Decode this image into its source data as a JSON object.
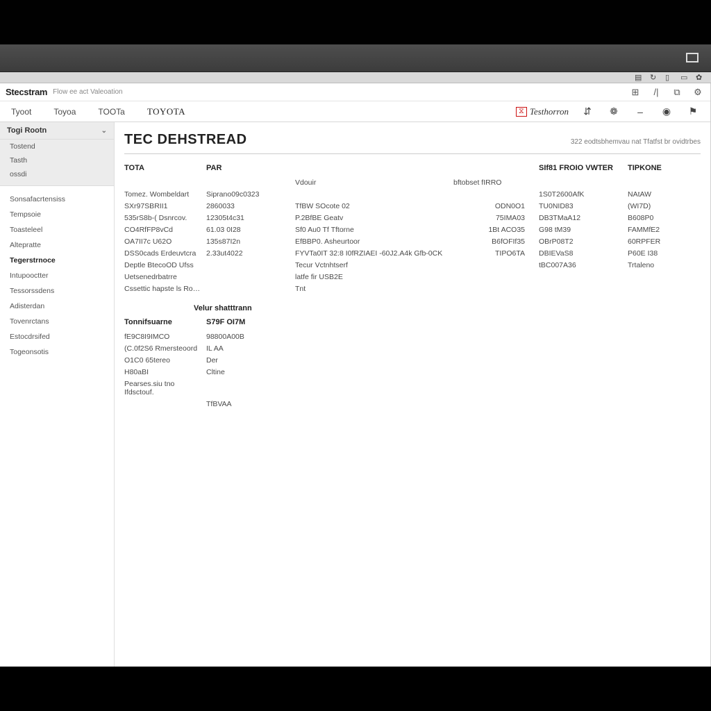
{
  "brand": {
    "name": "Stecstram",
    "sub": "Flow ee act  Valeoation"
  },
  "topTabs": [
    "Tyoot",
    "Toyoa",
    "TOOTa",
    "TOYOTA"
  ],
  "logo2": "Testhorron",
  "toolIcons": [
    "chart-icon",
    "gear-icon",
    "dash-icon",
    "globe-icon",
    "flag-icon"
  ],
  "sidebar": {
    "head": "Togi Rootn",
    "group1": [
      "Tostend",
      "Tasth",
      "ossdi"
    ],
    "group2": [
      {
        "label": "Sonsafacrtensiss",
        "bold": false
      },
      {
        "label": "Tempsoie",
        "bold": false
      },
      {
        "label": "Toasteleel",
        "bold": false
      },
      {
        "label": "Altepratte",
        "bold": false
      },
      {
        "label": "Tegerstrnoce",
        "bold": true
      },
      {
        "label": "Intupooctter",
        "bold": false
      },
      {
        "label": "Tessorssdens",
        "bold": false
      },
      {
        "label": "Adisterdan",
        "bold": false
      },
      {
        "label": "Tovenrctans",
        "bold": false
      },
      {
        "label": "Estocdrsifed",
        "bold": false
      },
      {
        "label": "Togeonsotis",
        "bold": false
      }
    ]
  },
  "page": {
    "title": "TEC DEHSTREAD",
    "meta": "322 eodtsbhemvau nat Tfatfst br ovidtrbes"
  },
  "table": {
    "headers": [
      "TOTA",
      "PAR",
      "",
      "",
      "SIf81 FROIO VWTER",
      "TIPKONE"
    ],
    "headerRow2": [
      "",
      "",
      "Vdouir",
      "bftobset fIRRO",
      "",
      ""
    ],
    "rows": [
      [
        "Tomez.  Wombeldart",
        "Siprano09c0323",
        "",
        "",
        "1S0T2600AfK",
        "NAtAW"
      ],
      [
        "SXr97SBRII1",
        "2860033",
        "TfBW SOcote 02",
        "ODN0O1",
        "TU0NID83",
        "(WI7D)"
      ],
      [
        "535rS8b-(  Dsnrcov.",
        "12305t4c31",
        "P.2BfBE Geatv",
        "75IMA03",
        "DB3TMaA12",
        "B608P0"
      ],
      [
        "CO4RfFP8vCd",
        "61.03 0I28",
        "Sf0 Au0  Tf  Tftorne",
        "1Bt ACO35",
        "G98 tM39",
        "FAMMfE2"
      ],
      [
        "OA7II7c U62O",
        "135s87I2n",
        "EfBBP0.  Asheurtoor",
        "B6fOFIf35",
        "OBrP08T2",
        "60RPFER"
      ],
      [
        "DSS0cads Erdeuvtcra",
        "2.33ut4022",
        "FYVTa0IT 32:8 I0fRZIAEI  -60J2.A4k Gfb-0CK",
        "TIPO6TA",
        "DBIEVaS8",
        "P60E  I38"
      ],
      [
        "Deptle BtecoOD Ufss",
        "",
        "Tecur Vctnhtserf",
        "",
        "tBC007A36",
        "Trtaleno"
      ],
      [
        "Uetsenedrbatrre",
        "",
        "latfe fir USB2E",
        "",
        "",
        ""
      ],
      [
        "Cssettic hapste ls Roonr in entey onerctuvert",
        "",
        "Tnt",
        "",
        "",
        ""
      ]
    ]
  },
  "subhead": "Velur  shatttrann",
  "table2": {
    "headers": [
      "Tonnifsuarne",
      "S79F OI7M"
    ],
    "rows": [
      [
        "fE9C8I9IMCO",
        "98800A00B"
      ],
      [
        "(C.0f2S6 Rmersteoord",
        "IL AA"
      ],
      [
        "O1C0 65tereo",
        "Der"
      ],
      [
        "H80aBI",
        "Cltine"
      ],
      [
        "Pearses.siu tno Ifdsctouf.",
        ""
      ],
      [
        "",
        "TfBVAA"
      ]
    ]
  }
}
